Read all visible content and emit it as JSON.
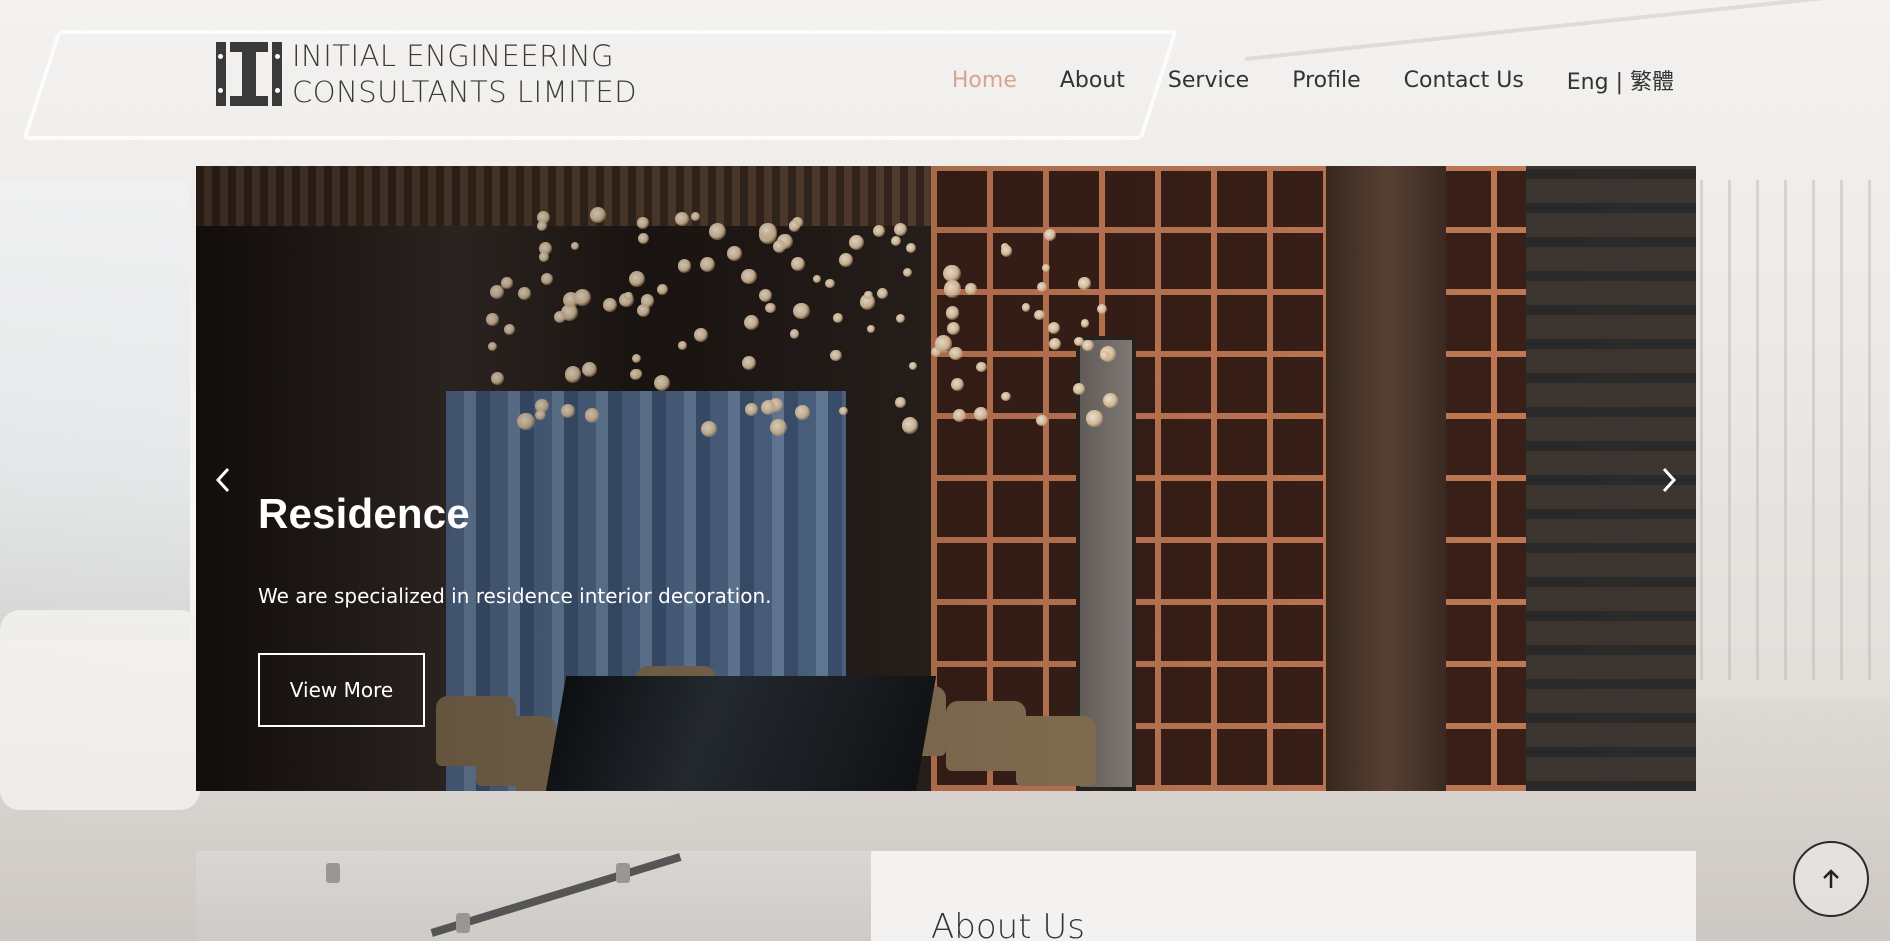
{
  "brand": {
    "line1": "INITIAL ENGINEERING",
    "line2": "CONSULTANTS LIMITED",
    "logo_icon": "ii-monogram-icon"
  },
  "nav": {
    "items": [
      {
        "label": "Home",
        "active": true
      },
      {
        "label": "About",
        "active": false
      },
      {
        "label": "Service",
        "active": false
      },
      {
        "label": "Profile",
        "active": false
      },
      {
        "label": "Contact Us",
        "active": false
      },
      {
        "label": "Eng | 繁體",
        "active": false
      }
    ],
    "active_color": "#d6a48f"
  },
  "hero": {
    "title": "Residence",
    "subtitle": "We are specialized in residence interior decoration.",
    "button_label": "View More",
    "prev_icon": "chevron-left-icon",
    "next_icon": "chevron-right-icon"
  },
  "about": {
    "title": "About Us"
  },
  "scroll_top_icon": "arrow-up-icon"
}
